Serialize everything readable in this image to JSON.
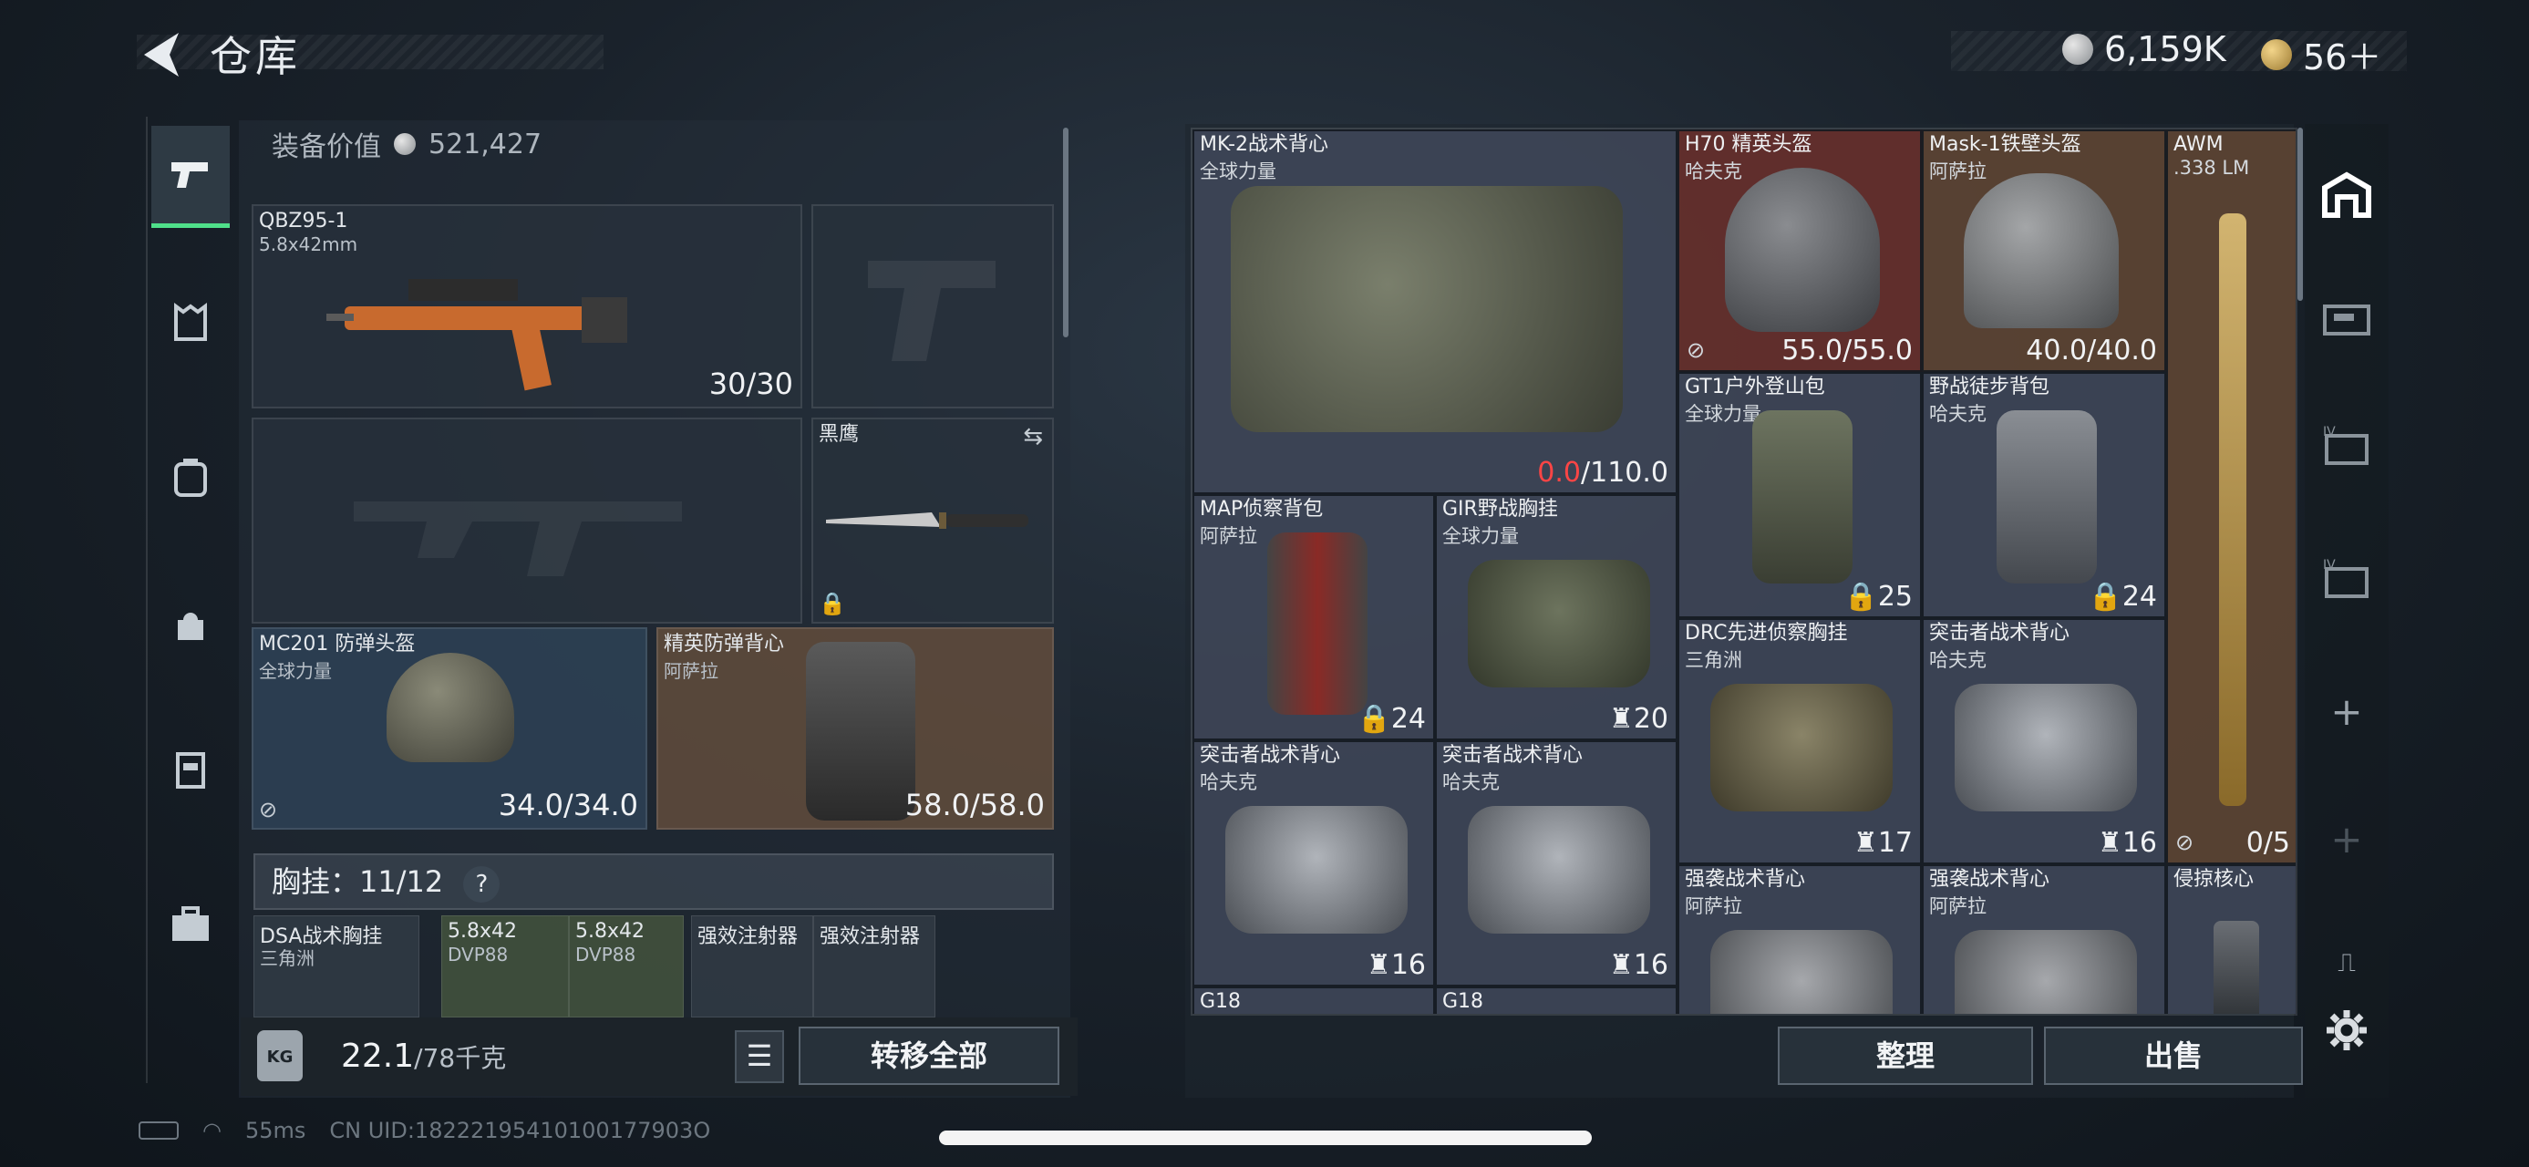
{
  "header": {
    "title": "仓库",
    "currency_silver": "6,159K",
    "currency_gold": "56＋"
  },
  "sidebar": {
    "items": [
      "weapon-tab",
      "armor-tab",
      "backpack-tab",
      "bag-tab",
      "chest-rig-tab",
      "case-tab"
    ]
  },
  "equipment": {
    "value_label": "装备价值",
    "value": "521,427",
    "primary_weapon": {
      "name": "QBZ95-1",
      "caliber": "5.8x42mm",
      "ammo": "30/30"
    },
    "melee": {
      "name": "黑鹰"
    },
    "helmet": {
      "name": "MC201 防弹头盔",
      "maker": "全球力量",
      "durability": "34.0/34.0"
    },
    "armor": {
      "name": "精英防弹背心",
      "maker": "阿萨拉",
      "durability": "58.0/58.0"
    },
    "chest_rig": {
      "label": "胸挂：11/12",
      "help": "?"
    },
    "chest_items": [
      {
        "name": "DSA战术胸挂",
        "sub": "三角洲"
      },
      {
        "name": "5.8x42",
        "sub": "DVP88"
      },
      {
        "name": "5.8x42",
        "sub": "DVP88"
      },
      {
        "name": "强效注射器",
        "sub": ""
      },
      {
        "name": "强效注射器",
        "sub": ""
      }
    ],
    "weight": "22.1",
    "weight_max": "/78千克",
    "kg_label": "KG",
    "list_icon": "☰",
    "transfer_label": "转移全部"
  },
  "storage": {
    "items": [
      {
        "name": "MK-2战术背心",
        "sub": "全球力量",
        "value_low": "0.0",
        "value_rest": "/110.0"
      },
      {
        "name": "H70 精英头盔",
        "sub": "哈夫克",
        "value": "55.0/55.0"
      },
      {
        "name": "Mask-1铁壁头盔",
        "sub": "阿萨拉",
        "value": "40.0/40.0"
      },
      {
        "name": "AWM",
        "sub": ".338 LM",
        "value": "0/5"
      },
      {
        "name": "GT1户外登山包",
        "sub": "全球力量",
        "value": "25"
      },
      {
        "name": "野战徒步背包",
        "sub": "哈夫克",
        "value": "24"
      },
      {
        "name": "MAP侦察背包",
        "sub": "阿萨拉",
        "value": "24"
      },
      {
        "name": "GIR野战胸挂",
        "sub": "全球力量",
        "value": "20"
      },
      {
        "name": "DRC先进侦察胸挂",
        "sub": "三角洲",
        "value": "17"
      },
      {
        "name": "突击者战术背心",
        "sub": "哈夫克",
        "value": "16"
      },
      {
        "name": "突击者战术背心",
        "sub": "哈夫克",
        "value": "16"
      },
      {
        "name": "突击者战术背心",
        "sub": "哈夫克",
        "value": "16"
      },
      {
        "name": "强袭战术背心",
        "sub": "阿萨拉",
        "value": ""
      },
      {
        "name": "强袭战术背心",
        "sub": "阿萨拉",
        "value": ""
      },
      {
        "name": "侵掠核心",
        "sub": "",
        "value": ""
      },
      {
        "name": "G18",
        "sub": "",
        "value": ""
      },
      {
        "name": "G18",
        "sub": "",
        "value": ""
      }
    ],
    "sort_label": "整理",
    "sell_label": "出售"
  },
  "status": {
    "ping": "55ms",
    "uid": "CN UID:18222195410100177903O"
  }
}
